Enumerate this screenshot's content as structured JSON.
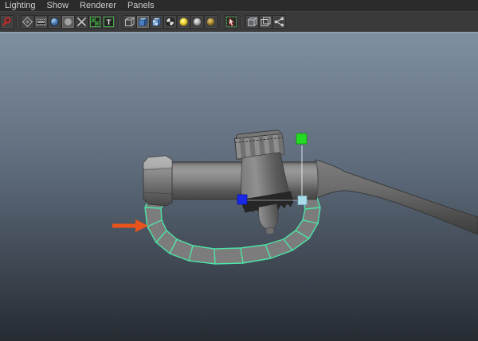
{
  "menubar": {
    "items": [
      {
        "label": "Lighting"
      },
      {
        "label": "Show"
      },
      {
        "label": "Renderer"
      },
      {
        "label": "Panels"
      }
    ]
  },
  "toolbar": {
    "icons": [
      "select",
      "camera-attributes",
      "film-gate",
      "resolution-gate",
      "gate-mask",
      "field-chart",
      "safe-action",
      "safe-title",
      "wireframe",
      "smooth-shade-all",
      "textured",
      "use-default-material",
      "lighting-all",
      "lighting-selected",
      "lighting-flat",
      "isolate-select",
      "x-ray",
      "wireframe-on-shaded",
      "plugin-shapes"
    ],
    "active_icon": "smooth-shade-all",
    "safe_title_glyph": "T"
  },
  "viewport": {
    "scene_description": "3D fuel pump nozzle model with selected trigger-guard polygon loop",
    "colors": {
      "bg_top": "#8090a1",
      "bg_bottom": "#262b32",
      "selection_green": "#4ee4a7",
      "selection_face": "#7c7c7c",
      "manip_axis_green": "#23db23",
      "manip_axis_blue": "#1828e6",
      "manip_center_cyan": "#a9dbe9",
      "annotation_orange": "#e8541b"
    }
  }
}
